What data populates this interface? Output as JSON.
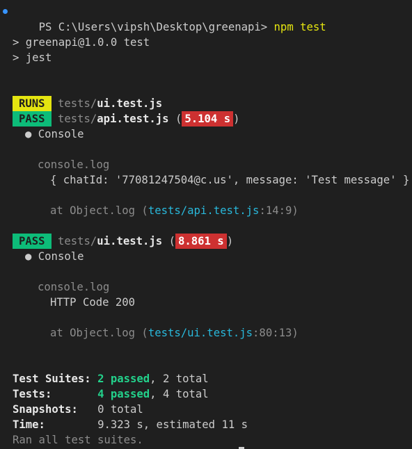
{
  "prompt": {
    "text": "PS C:\\Users\\vipsh\\Desktop\\greenapi> ",
    "command": "npm test"
  },
  "npm": {
    "line1": "> greenapi@1.0.0 test",
    "line2": "> jest"
  },
  "runs_badge": "RUNS",
  "runs_file_dir": "tests/",
  "runs_file_name": "ui.test.js",
  "suite_api": {
    "badge": "PASS",
    "dir": "tests/",
    "file": "api.test.js",
    "time": "5.104 s",
    "console_label": "Console",
    "log_header": "console.log",
    "log_body": "{ chatId: '77081247504@c.us', message: 'Test message' }",
    "at_prefix": "at Object.log (",
    "at_link": "tests/api.test.js",
    "at_loc": ":14:9",
    "at_suffix": ")"
  },
  "suite_ui": {
    "badge": "PASS",
    "dir": "tests/",
    "file": "ui.test.js",
    "time": "8.861 s",
    "console_label": "Console",
    "log_header": "console.log",
    "log_body": "HTTP Code 200",
    "at_prefix": "at Object.log (",
    "at_link": "tests/ui.test.js",
    "at_loc": ":80:13",
    "at_suffix": ")"
  },
  "summary": {
    "suites_label": "Test Suites:",
    "suites_passed": "2 passed",
    "suites_total": ", 2 total",
    "tests_label": "Tests:",
    "tests_passed": "4 passed",
    "tests_total": ", 4 total",
    "snapshots_label": "Snapshots:",
    "snapshots_value": "0 total",
    "time_label": "Time:",
    "time_value": "9.323 s, estimated 11 s",
    "footer": "Ran all test suites."
  },
  "colors": {
    "background": "#1f1f1f",
    "pass": "#0dbc79",
    "runs": "#e5e510",
    "time_badge": "#cd3131",
    "link": "#29b8db"
  }
}
